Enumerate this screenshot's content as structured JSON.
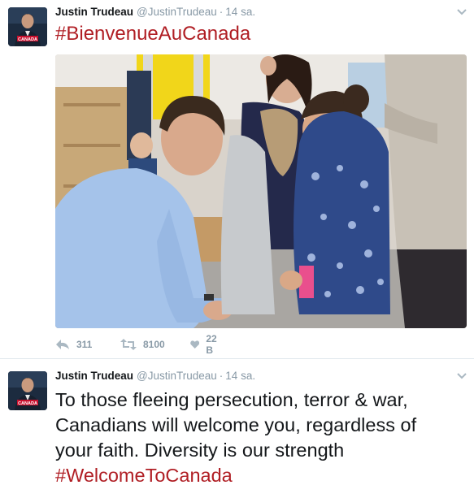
{
  "tweets": [
    {
      "author_name": "Justin Trudeau",
      "handle": "@JustinTrudeau",
      "separator": "·",
      "time": "14 sa.",
      "text": "#BienvenueAuCanada",
      "stats": {
        "replies": "311",
        "retweets": "8100",
        "likes": "22 B"
      }
    },
    {
      "author_name": "Justin Trudeau",
      "handle": "@JustinTrudeau",
      "separator": "·",
      "time": "14 sa.",
      "text_line1": "To those fleeing persecution, terror & war,",
      "text_line2": "Canadians will welcome you, regardless of",
      "text_line3": "your faith. Diversity is our strength",
      "hashtag": "#WelcomeToCanada"
    }
  ],
  "colors": {
    "hashtag": "#b01e24",
    "muted": "#8899a6",
    "divider": "#e1e8ed",
    "text": "#14171a"
  },
  "icons": [
    "chevron-down-icon",
    "reply-icon",
    "retweet-icon",
    "heart-icon"
  ],
  "avatar_badge_text": "CANADA"
}
